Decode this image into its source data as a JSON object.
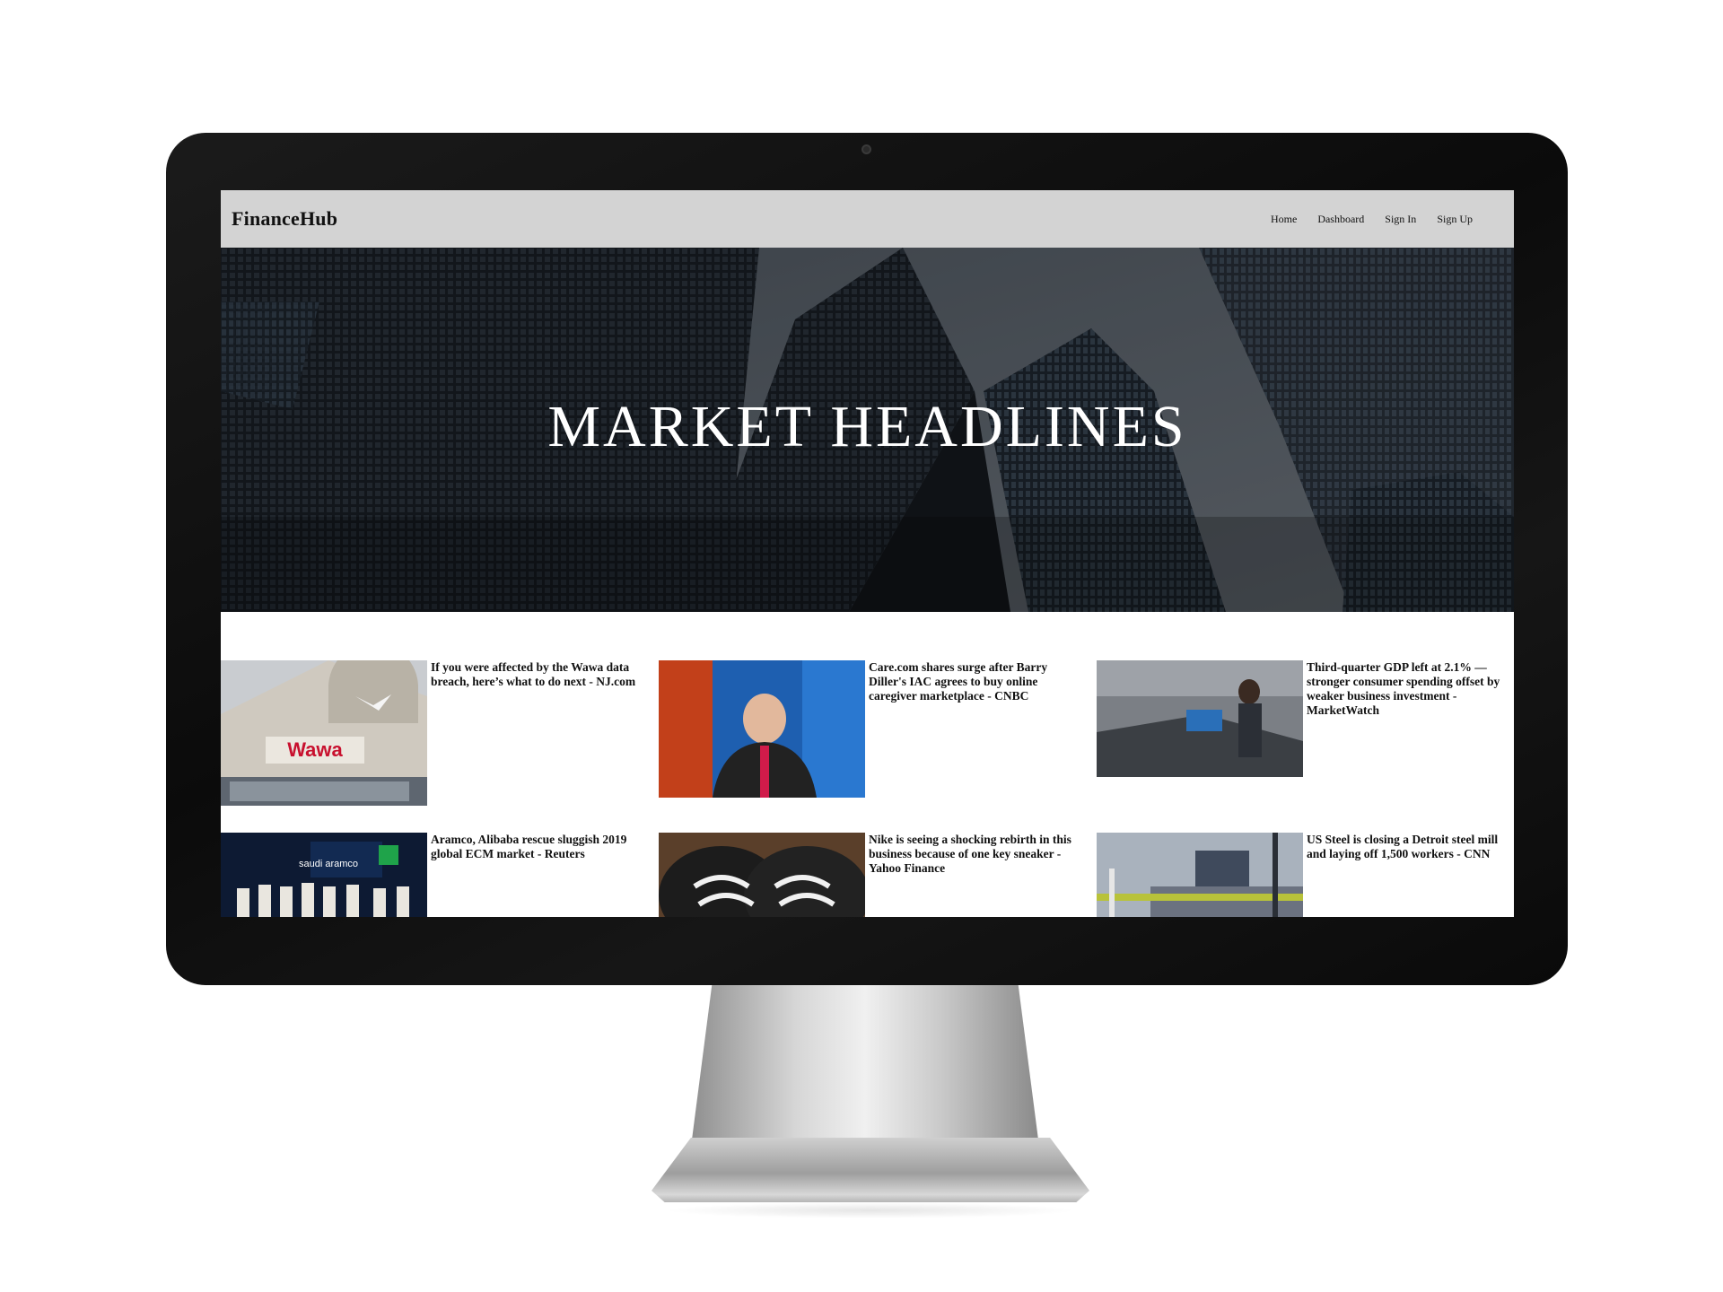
{
  "header": {
    "brand": "FinanceHub",
    "nav": [
      "Home",
      "Dashboard",
      "Sign In",
      "Sign Up"
    ]
  },
  "hero": {
    "title": "MARKET HEADLINES"
  },
  "news": [
    {
      "title": "If you were affected by the Wawa data breach, here’s what to do next - NJ.com",
      "thumb_text": "Wawa"
    },
    {
      "title": "Care.com shares surge after Barry Diller's IAC agrees to buy online caregiver marketplace - CNBC",
      "thumb_text": ""
    },
    {
      "title": "Third-quarter GDP left at 2.1% — stronger consumer spending offset by weaker business investment - MarketWatch",
      "thumb_text": ""
    },
    {
      "title": "Aramco, Alibaba rescue sluggish 2019 global ECM market - Reuters",
      "thumb_text": "saudi aramco"
    },
    {
      "title": "Nike is seeing a shocking rebirth in this business because of one key sneaker - Yahoo Finance",
      "thumb_text": ""
    },
    {
      "title": "US Steel is closing a Detroit steel mill and laying off 1,500 workers - CNN",
      "thumb_text": ""
    }
  ],
  "colors": {
    "navbar": "#d3d3d3",
    "wawa_red": "#c8102e"
  }
}
